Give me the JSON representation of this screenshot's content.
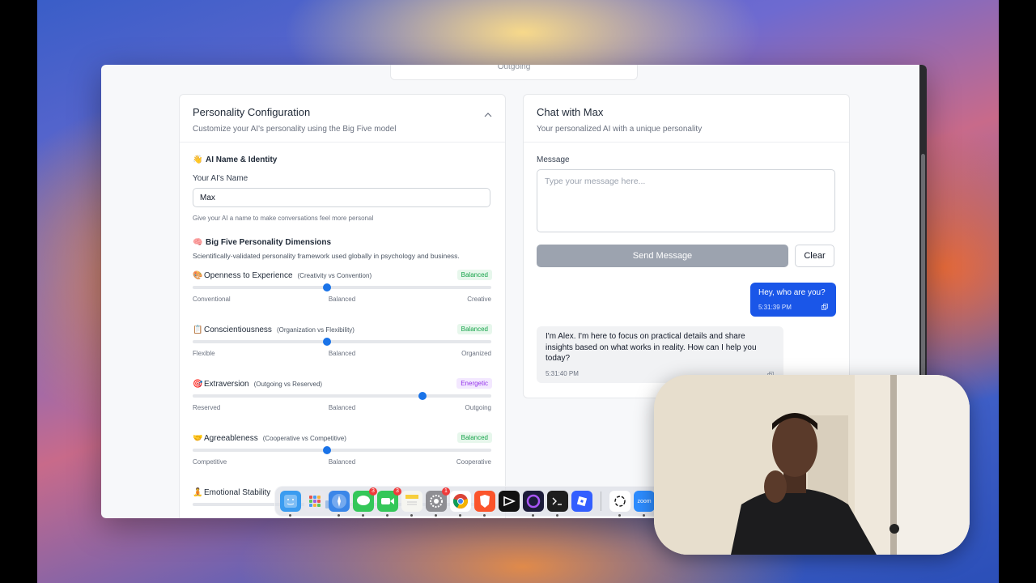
{
  "top_card": {
    "text": "Outgoing"
  },
  "config": {
    "title": "Personality Configuration",
    "subtitle": "Customize your AI's personality using the Big Five model",
    "identity": {
      "emoji": "👋",
      "title": "AI Name & Identity",
      "name_label": "Your AI's Name",
      "name_value": "Max",
      "hint": "Give your AI a name to make conversations feel more personal"
    },
    "big_five": {
      "emoji": "🧠",
      "title": "Big Five Personality Dimensions",
      "subtitle": "Scientifically-validated personality framework used globally in psychology and business."
    },
    "traits": [
      {
        "emoji": "🎨",
        "name": "Openness to Experience",
        "desc": "(Creativity vs Convention)",
        "badge": "Balanced",
        "badge_type": "green",
        "value": 0.45,
        "low": "Conventional",
        "mid": "Balanced",
        "high": "Creative"
      },
      {
        "emoji": "📋",
        "name": "Conscientiousness",
        "desc": "(Organization vs Flexibility)",
        "badge": "Balanced",
        "badge_type": "green",
        "value": 0.45,
        "low": "Flexible",
        "mid": "Balanced",
        "high": "Organized"
      },
      {
        "emoji": "🎯",
        "name": "Extraversion",
        "desc": "(Outgoing vs Reserved)",
        "badge": "Energetic",
        "badge_type": "purple",
        "value": 0.77,
        "low": "Reserved",
        "mid": "Balanced",
        "high": "Outgoing"
      },
      {
        "emoji": "🤝",
        "name": "Agreeableness",
        "desc": "(Cooperative vs Competitive)",
        "badge": "Balanced",
        "badge_type": "green",
        "value": 0.45,
        "low": "Competitive",
        "mid": "Balanced",
        "high": "Cooperative"
      },
      {
        "emoji": "🧘",
        "name": "Emotional Stability",
        "desc": "",
        "badge": "",
        "badge_type": "green",
        "value": 0.45,
        "low": "",
        "mid": "",
        "high": ""
      }
    ]
  },
  "chat": {
    "title": "Chat with Max",
    "subtitle": "Your personalized AI with a unique personality",
    "message_label": "Message",
    "placeholder": "Type your message here...",
    "send_label": "Send Message",
    "clear_label": "Clear",
    "messages": {
      "user": {
        "text": "Hey, who are you?",
        "time": "5:31:39 PM"
      },
      "ai": {
        "text": "I'm Alex. I'm here to focus on practical details and share insights based on what works in reality. How can I help you today?",
        "time": "5:31:40 PM"
      }
    }
  },
  "dock": {
    "badges": {
      "messages": "3",
      "facetime": "3",
      "settings": "1"
    },
    "zoom_label": "zoom",
    "colors": {
      "finder": "#3b9cf0",
      "launchpad": "#e8e8ee",
      "safari": "#3a86e8",
      "messages": "#34c759",
      "facetime": "#34c759",
      "notes": "#f5f5f0",
      "settings": "#8e8e93",
      "chrome": "#ffffff",
      "brave": "#fb542b",
      "capcut": "#111111",
      "arc": "#1c1c3a",
      "terminal": "#1e1e1e",
      "roblox": "#335fff",
      "chatgpt": "#ffffff",
      "zoom": "#2d8cff"
    }
  }
}
